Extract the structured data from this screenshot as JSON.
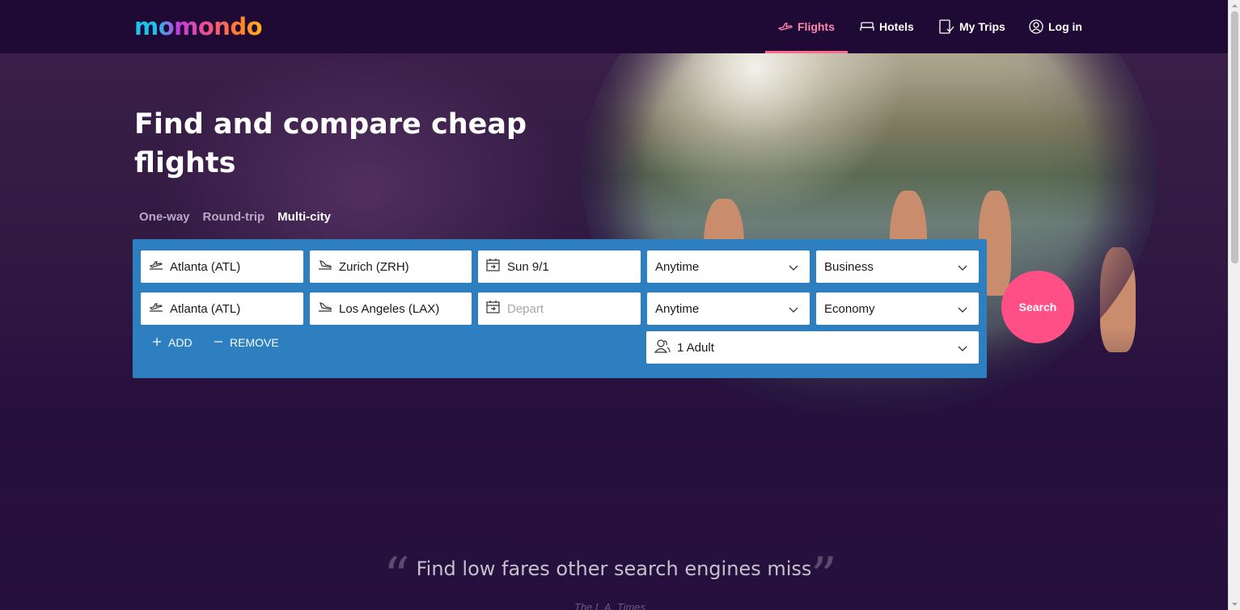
{
  "brand": {
    "logo_text": "momondo"
  },
  "nav": {
    "flights": "Flights",
    "hotels": "Hotels",
    "trips": "My Trips",
    "login": "Log in"
  },
  "hero": {
    "title": "Find and compare cheap flights"
  },
  "trip_types": {
    "one_way": "One-way",
    "round_trip": "Round-trip",
    "multi_city": "Multi-city",
    "selected": "Multi-city"
  },
  "legs": [
    {
      "origin": "Atlanta (ATL)",
      "destination": "Zurich (ZRH)",
      "date": "Sun 9/1",
      "time": "Anytime",
      "cabin": "Business"
    },
    {
      "origin": "Atlanta (ATL)",
      "destination": "Los Angeles (LAX)",
      "date_placeholder": "Depart",
      "time": "Anytime",
      "cabin": "Economy"
    }
  ],
  "actions": {
    "add": "ADD",
    "remove": "REMOVE",
    "search": "Search"
  },
  "travelers": "1 Adult",
  "quote": {
    "text": "Find low fares other search engines miss",
    "source": "The L.A. Times"
  },
  "colors": {
    "accent": "#ff4f86",
    "panel": "#2e7fbf",
    "background": "#250f3e",
    "nav": "#1f0a35"
  }
}
